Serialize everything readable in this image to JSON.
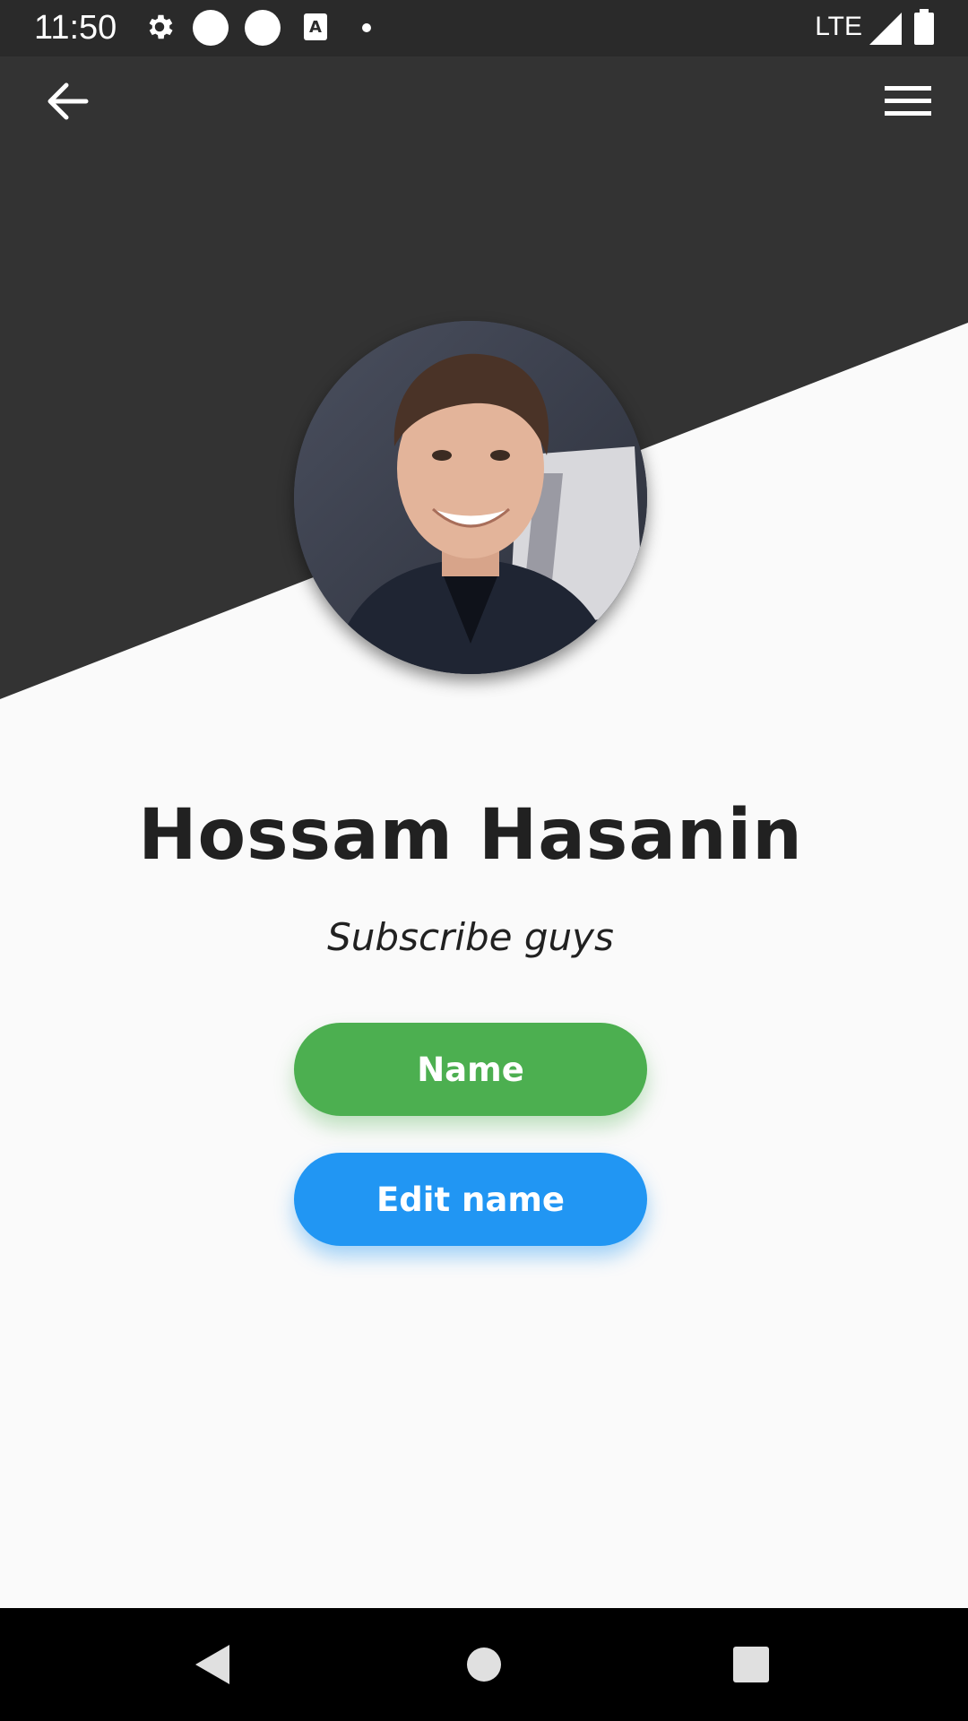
{
  "status_bar": {
    "time": "11:50",
    "network": "LTE",
    "icons": [
      "settings-icon",
      "circle-notification-icon",
      "circle-notification-icon",
      "text-a-icon",
      "dot-icon",
      "signal-icon",
      "battery-icon"
    ]
  },
  "app_bar": {
    "back_icon": "arrow-left-icon",
    "menu_icon": "hamburger-menu-icon"
  },
  "profile": {
    "name": "Hossam Hasanin",
    "subtitle": "Subscribe guys"
  },
  "buttons": {
    "name_label": "Name",
    "edit_label": "Edit name"
  },
  "colors": {
    "header_dark": "#333333",
    "background": "#fafafa",
    "name_button": "#4caf50",
    "edit_button": "#2196f3",
    "text": "#212121"
  },
  "nav_bar": {
    "icons": [
      "back-triangle-icon",
      "home-circle-icon",
      "recents-square-icon"
    ]
  }
}
